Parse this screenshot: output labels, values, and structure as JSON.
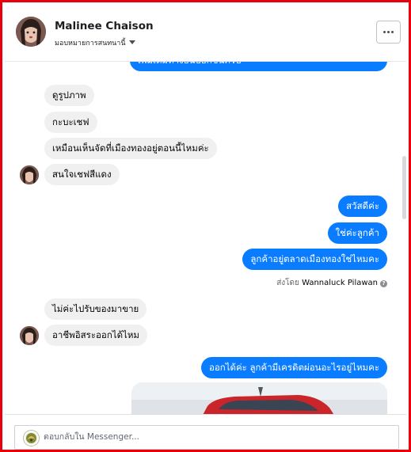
{
  "header": {
    "name": "Malinee Chaison",
    "assign_label": "มอบหมายการสนทนานี้",
    "more_label": "..."
  },
  "messages": {
    "top_partial": "เพิ่มเติมทางอื่นบอกขั้นครับ ***",
    "incoming_1": "ดูรูปภาพ",
    "incoming_2": "กะบะเชฟ",
    "incoming_3": "เหมือนเห็นจัดที่เมืองทองอยู่ตอนนี้ไหมค่ะ",
    "incoming_4": "สนใจเชฟสีแดง",
    "outgoing_1": "สวัสดีค่ะ",
    "outgoing_2": "ใช่ค่ะลูกค้า",
    "outgoing_3": "ลูกค้าอยู่ตลาดเมืองทองใช่ไหมคะ",
    "sent_by_prefix": "ส่งโดย",
    "sent_by_name": "Wannaluck Pilawan",
    "incoming_5": "ไม่ค่ะไปรับของมาขาย",
    "incoming_6": "อาชีพอิสระออกได้ไหม",
    "outgoing_4": "ออกได้ค่ะ ลูกค้ามีเครดิตผ่อนอะไรอยู่ไหมคะ"
  },
  "composer": {
    "placeholder": "ตอบกลับใน Messenger..."
  },
  "colors": {
    "accent": "#0a7cff",
    "incoming_bubble": "#f1f0f0",
    "frame_border": "#e8000b"
  }
}
